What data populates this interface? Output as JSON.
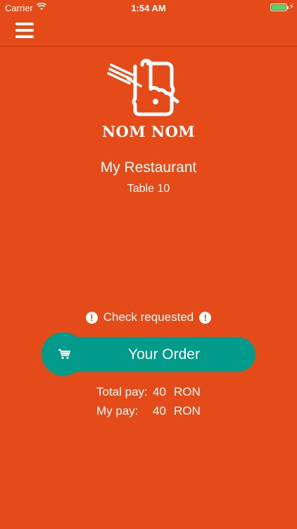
{
  "status_bar": {
    "carrier": "Carrier",
    "time": "1:54 AM",
    "battery_color": "#4CD964"
  },
  "nav": {
    "menu_icon": "hamburger-menu-icon"
  },
  "logo": {
    "text": "NOM NOM"
  },
  "restaurant": {
    "name": "My Restaurant",
    "table": "Table 10"
  },
  "check_status": {
    "text": "Check requested",
    "icon": "!"
  },
  "order_button": {
    "label": "Your Order",
    "icon": "cart-icon"
  },
  "payment": {
    "total_label": "Total pay:",
    "total_amount": "40",
    "total_currency": "RON",
    "my_label": "My pay:",
    "my_amount": "40",
    "my_currency": "RON"
  },
  "colors": {
    "background": "#E54B18",
    "accent": "#009B8B",
    "text": "#FFFFFF"
  }
}
